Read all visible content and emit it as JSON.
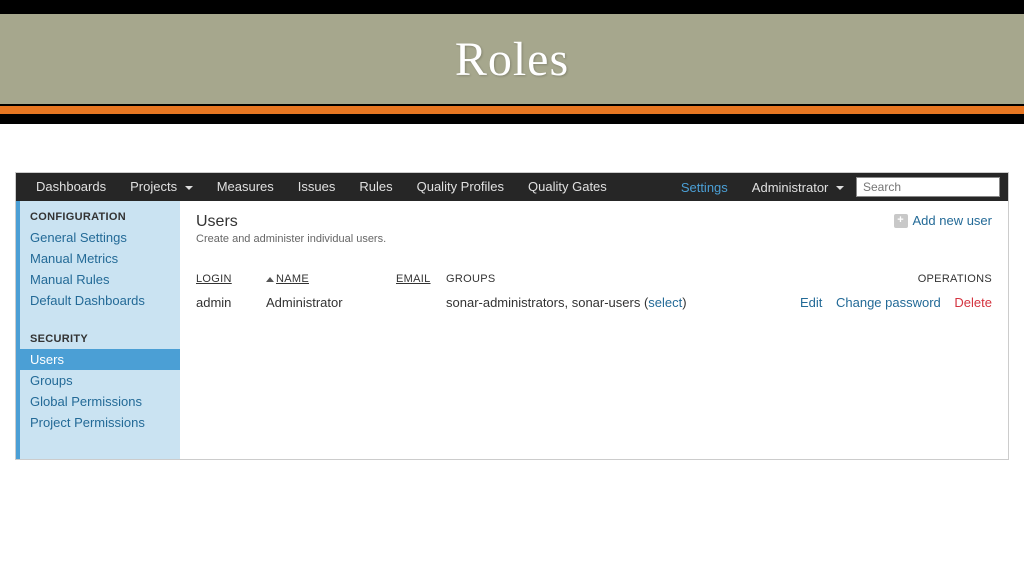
{
  "slide": {
    "title": "Roles"
  },
  "nav": {
    "items": [
      "Dashboards",
      "Projects",
      "Measures",
      "Issues",
      "Rules",
      "Quality Profiles",
      "Quality Gates"
    ],
    "settings": "Settings",
    "user": "Administrator",
    "search_placeholder": "Search"
  },
  "sidebar": {
    "section1_title": "CONFIGURATION",
    "section1_items": [
      "General Settings",
      "Manual Metrics",
      "Manual Rules",
      "Default Dashboards"
    ],
    "section2_title": "SECURITY",
    "section2_items": [
      "Users",
      "Groups",
      "Global Permissions",
      "Project Permissions"
    ],
    "active": "Users"
  },
  "page": {
    "heading": "Users",
    "sub": "Create and administer individual users.",
    "add_label": "Add new user"
  },
  "table": {
    "cols": {
      "login": "LOGIN",
      "name": "NAME",
      "email": "EMAIL",
      "groups": "GROUPS",
      "ops": "OPERATIONS"
    },
    "row": {
      "login": "admin",
      "name": "Administrator",
      "email": "",
      "groups_text": "sonar-administrators, sonar-users (",
      "select_label": "select",
      "groups_close": ")",
      "edit": "Edit",
      "change_pw": "Change password",
      "delete": "Delete"
    }
  }
}
